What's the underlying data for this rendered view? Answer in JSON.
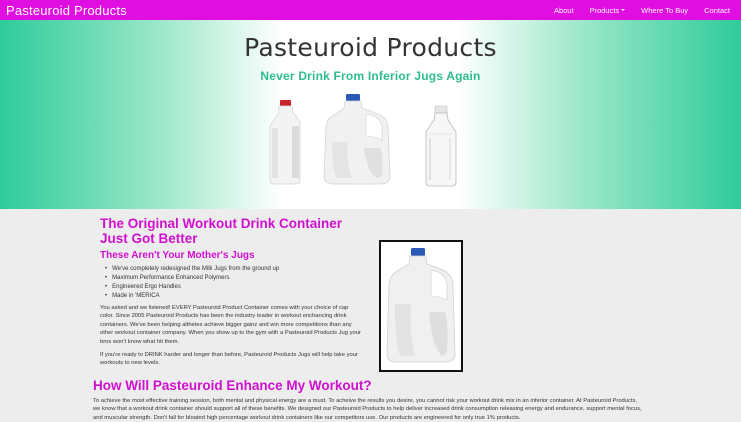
{
  "nav": {
    "brand": "Pasteuroid Products",
    "links": [
      "About",
      "Products",
      "Where To Buy",
      "Contact"
    ]
  },
  "hero": {
    "title": "Pasteuroid Products",
    "subtitle": "Never Drink From Inferior Jugs Again"
  },
  "main": {
    "heading": "The Original Workout Drink Container Just Got Better",
    "subheading": "These Aren't Your Mother's Jugs",
    "features": [
      "We've completely redesigned the Milk Jugs from the ground up",
      "Maximum Performance Enhanced Polymers",
      "Engineered Ergo Handles",
      "Made in 'MERICA"
    ],
    "paragraph1": "You asked and we listened! EVERY Pasteuroid Product Container comes with your choice of cap color. Since 2005 Pasteuroid Products has been the industry leader in workout enchancing drink containers. We've been helping althetes achieve bigger gainz and win more competitions than any other workout container company. When you show up to the gym with a Pasteuroid Products Jug your bros won't know what hit them.",
    "paragraph2": "If you're ready to DRINK harder and longer than before, Pasteuroid Products Jugs will help take your workouts to new levels.",
    "heading2": "How Will Pasteuroid Enhance My Workout?",
    "paragraph3": "To achieve the most effective training session, both mental and physical energy are a must. To acheive the results you desire, you cannot risk your workout drink mix in an inferior container. At Pasteuroid Products, we know that a workout drink container should support all of these benefits. We designed our Pasteuroid Products to help deliver increased drink consumption releasing energy and endurance, support mental focus, and muscular strength. Don't fall for bloated high percentage workout drink containers like our competitors use. Our products are engineered for only true 1% products."
  },
  "colors": {
    "brand": "#e10ee1",
    "heading": "#d10fd1",
    "accent": "#2ebd8a"
  }
}
